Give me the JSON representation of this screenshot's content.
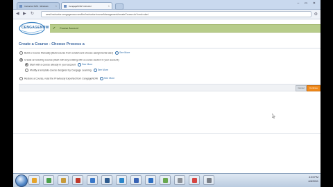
{
  "browser": {
    "tabs": [
      {
        "label": "Instructor XMS - Windows"
      },
      {
        "label": "CengageNOW Instructor"
      }
    ],
    "url": "west.instructor.cengagenow.com/ilrn/instructor/courseManagement/createCourse.do?cmd=start",
    "window_controls": "– ▭ ✕"
  },
  "header": {
    "logo_text": "CENGAGENOW",
    "message": "Course Account"
  },
  "page": {
    "title": "Create a Course - Choose Process a",
    "options": [
      {
        "label": "Build a Course Manually (Build course from scratch and choose assignments later)",
        "more": "See More"
      },
      {
        "label": "Create an Existing Course (Start with any existing with a course section in your account)",
        "more": ""
      },
      {
        "label": "Start with a course already in your account",
        "more": "See More"
      },
      {
        "label": "Modify a template course designed by Cengage Learning",
        "more": "See More"
      },
      {
        "label": "Restore a Course, read the Previously Exported from CengageNOW",
        "more": "See More"
      }
    ],
    "buttons": {
      "cancel": "Cancel",
      "next": "Continue"
    }
  },
  "taskbar": {
    "clock_time": "4:23 PM",
    "clock_date": "6/8/2011",
    "app_colors": [
      "#e6a42a",
      "#4aa04a",
      "#c89b3a",
      "#c0392b",
      "#3a78c9",
      "#2f5c8f",
      "#2c86c9",
      "#3a64b5",
      "#2e6fc1",
      "#6aa84f",
      "#8a8f96",
      "#d64541",
      "#7a7f87"
    ]
  }
}
